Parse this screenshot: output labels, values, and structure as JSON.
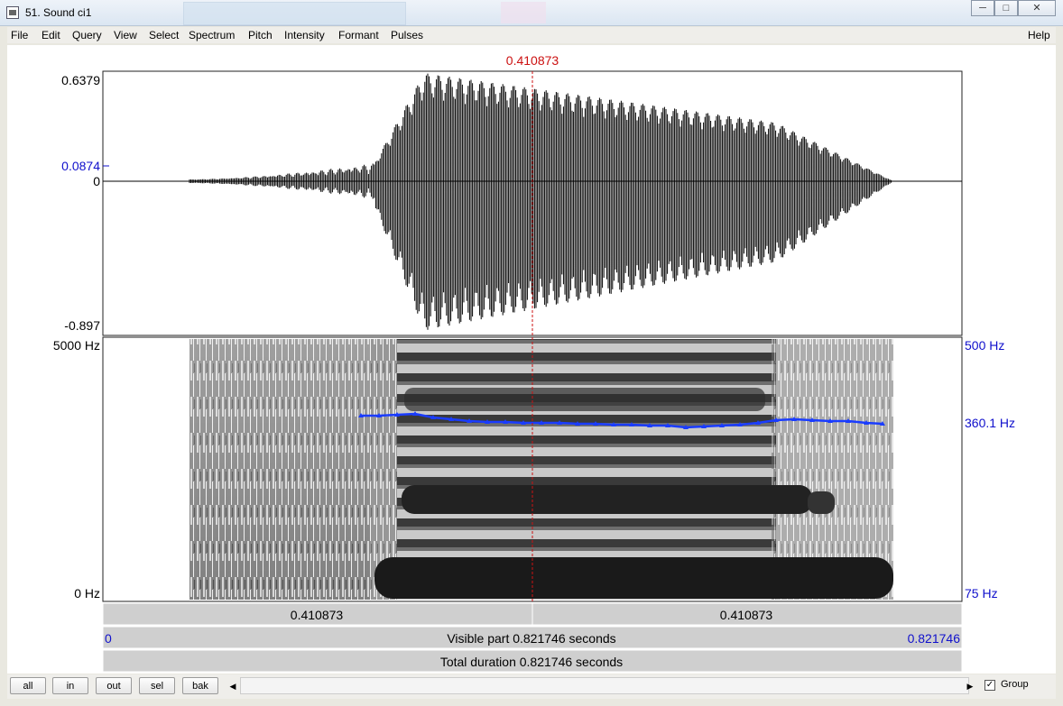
{
  "window": {
    "title": "51. Sound ci1",
    "minimize_icon": "minimize-icon",
    "maximize_icon": "maximize-icon",
    "close_icon": "close-icon"
  },
  "menu": [
    "File",
    "Edit",
    "Query",
    "View",
    "Select",
    "Spectrum",
    "Pitch",
    "Intensity",
    "Formant",
    "Pulses"
  ],
  "help": "Help",
  "cursor_time": "0.410873",
  "waveform": {
    "max": "0.6379",
    "cursor_value": "0.0874",
    "zero": "0",
    "min": "-0.897"
  },
  "spectrogram": {
    "freq_top": "5000 Hz",
    "freq_bottom": "0 Hz"
  },
  "pitch": {
    "top": "500 Hz",
    "value": "360.1 Hz",
    "bottom": "75 Hz"
  },
  "bars": {
    "left_part": "0.410873",
    "right_part": "0.410873",
    "visible_start": "0",
    "visible_label": "Visible part 0.821746 seconds",
    "visible_end": "0.821746",
    "total_label": "Total duration 0.821746 seconds"
  },
  "buttons": {
    "all": "all",
    "in": "in",
    "out": "out",
    "sel": "sel",
    "bak": "bak"
  },
  "group": {
    "label": "Group",
    "checked": true
  },
  "colors": {
    "cursor": "#cc1111",
    "blue_label": "#1010cc",
    "pitch_line": "#1a3cff"
  }
}
